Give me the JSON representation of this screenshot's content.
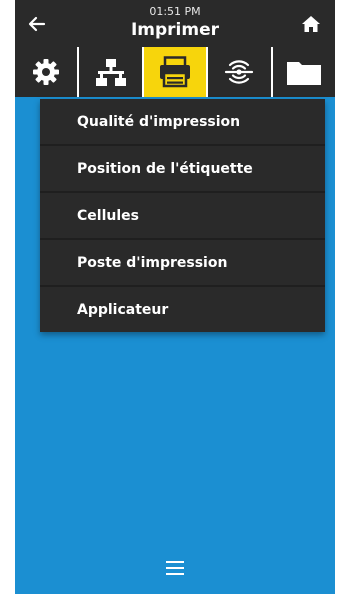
{
  "header": {
    "time": "01:51 PM",
    "title": "Imprimer",
    "back_icon": "back-arrow-icon",
    "home_icon": "home-icon"
  },
  "tabs": [
    {
      "icon": "gear-icon",
      "active": false
    },
    {
      "icon": "network-icon",
      "active": false
    },
    {
      "icon": "printer-icon",
      "active": true
    },
    {
      "icon": "wireless-icon",
      "active": false
    },
    {
      "icon": "folder-icon",
      "active": false
    }
  ],
  "menu": {
    "items": [
      {
        "label": "Qualité d'impression"
      },
      {
        "label": "Position de l'étiquette"
      },
      {
        "label": "Cellules"
      },
      {
        "label": "Poste d'impression"
      },
      {
        "label": "Applicateur"
      }
    ]
  },
  "footer": {
    "menu_icon": "hamburger-menu-icon"
  },
  "colors": {
    "header_bg": "#2a2a2a",
    "active_tab": "#f7d50c",
    "background": "#1b8fd2",
    "menu_bg": "#2a2a2a"
  }
}
